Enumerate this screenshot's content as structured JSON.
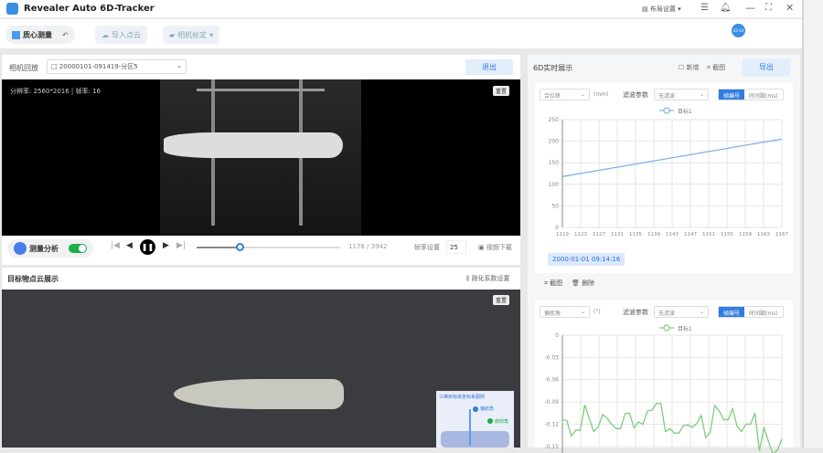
{
  "app": {
    "title": "Revealer Auto 6D-Tracker",
    "layout_settings": "布局设置",
    "time_badge": "02:44"
  },
  "toolbar": {
    "centroid": "质心测量",
    "import_cloud": "导入点云",
    "camera_calib": "相机标定"
  },
  "camera": {
    "label": "相机回放",
    "file": "20000101-091419-分区5",
    "exit": "退出",
    "info": "分辨率: 2560*2016 | 帧率: 16",
    "reset": "重置"
  },
  "playback": {
    "measure": "测量分析",
    "progress_text": "1176 / 3942",
    "progress": 0.298,
    "fps_label": "帧率设置",
    "fps": "25",
    "download": "视频下载"
  },
  "cloud": {
    "title": "目标物点云展示",
    "settings": "刚化系数设置",
    "reset": "重置",
    "legend_title": "三维目标体坐标系图例",
    "yaw": "偏航角",
    "pitch": "俯仰角"
  },
  "panel": {
    "title": "6D实时展示",
    "add": "新增",
    "screenshot": "截图",
    "export": "导出",
    "delete": "删除",
    "timestamp": "2000-01-01 09:14:16"
  },
  "chart_data": [
    {
      "type": "line",
      "metric": "合位移",
      "unit": "(mm)",
      "filter_label": "滤波参数",
      "filter": "无滤波",
      "mode_frame": "帧编号",
      "mode_time": "时间戳(ms)",
      "legend": "目标1",
      "color": "#7fb0e6",
      "x_ticks": [
        1119,
        1123,
        1127,
        1131,
        1135,
        1139,
        1143,
        1147,
        1151,
        1155,
        1159,
        1163,
        1167
      ],
      "ylim": [
        0,
        250
      ],
      "y_ticks": [
        0,
        50,
        100,
        150,
        200,
        250
      ],
      "x": [
        1119,
        1167
      ],
      "y": [
        118,
        205
      ]
    },
    {
      "type": "line",
      "metric": "偏航角",
      "unit": "(°)",
      "filter_label": "滤波参数",
      "filter": "无滤波",
      "mode_frame": "帧编号",
      "mode_time": "时间戳(ms)",
      "legend": "目标1",
      "color": "#7dcc7d",
      "ylim": [
        -0.165,
        0
      ],
      "y_ticks": [
        0,
        -0.03,
        -0.06,
        -0.09,
        -0.12,
        -0.15
      ],
      "y": [
        -0.114,
        -0.115,
        -0.136,
        -0.128,
        -0.128,
        -0.094,
        -0.112,
        -0.13,
        -0.124,
        -0.107,
        -0.112,
        -0.12,
        -0.126,
        -0.126,
        -0.106,
        -0.105,
        -0.125,
        -0.117,
        -0.12,
        -0.102,
        -0.101,
        -0.092,
        -0.092,
        -0.13,
        -0.126,
        -0.132,
        -0.132,
        -0.122,
        -0.121,
        -0.124,
        -0.119,
        -0.108,
        -0.138,
        -0.131,
        -0.095,
        -0.102,
        -0.114,
        -0.114,
        -0.099,
        -0.123,
        -0.13,
        -0.12,
        -0.12,
        -0.105,
        -0.156,
        -0.125,
        -0.143,
        -0.16,
        -0.155,
        -0.14
      ]
    }
  ]
}
